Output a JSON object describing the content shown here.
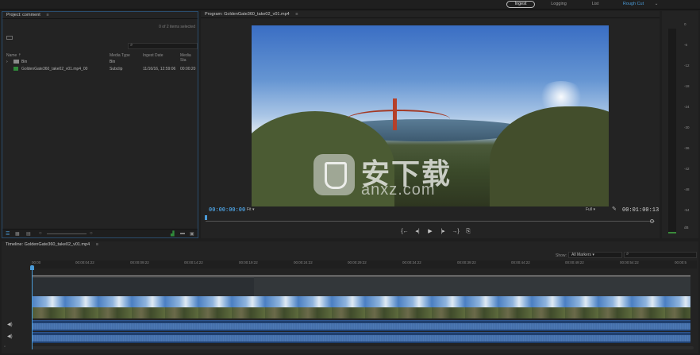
{
  "workspaces": {
    "tabs": [
      {
        "label": "Ingest",
        "active": true
      },
      {
        "label": "Logging",
        "active": false
      },
      {
        "label": "List",
        "active": false
      },
      {
        "label": "Rough Cut",
        "active": false
      }
    ],
    "more_icon": "chevron-down-icon"
  },
  "project": {
    "title": "Project: comment",
    "menu_icon": "≡",
    "selection_count": "0 of 2 items selected",
    "columns": [
      "Name ⇡",
      "Media Type",
      "Ingest Date",
      "Media Sta"
    ],
    "rows": [
      {
        "name": "Bin",
        "type": "Bin",
        "date": "",
        "status": "",
        "icon": "folder-icon"
      },
      {
        "name": "GoldenGate360_take02_v01.mp4_00",
        "type": "Subclip",
        "date": "11/16/16, 12:59:06",
        "status": "00:00:20",
        "icon": "subclip-icon"
      }
    ]
  },
  "program": {
    "title": "Program: GoldenGate360_take02_v01.mp4",
    "menu_icon": "≡",
    "timecode_current": "00:00:00:00",
    "zoom_fit": "Fit",
    "resolution": "Full",
    "timecode_duration": "00:01:00:13",
    "transport": [
      "{←",
      "◂|",
      "▶",
      "|▸",
      "→}",
      "⎘"
    ]
  },
  "watermark": {
    "chinese": "安下载",
    "domain": "anxz.com"
  },
  "meter": {
    "labels": [
      "0",
      "-6",
      "-12",
      "-18",
      "-24",
      "-30",
      "-36",
      "-42",
      "-48",
      "-54",
      "dB"
    ]
  },
  "timeline": {
    "title": "Timeline: GoldenGate360_take02_v01.mp4",
    "menu_icon": "≡",
    "show_label": "Show:",
    "show_value": "All Markers",
    "ruler_ticks": [
      "00:00",
      "00:00:04:22",
      "00:00:09:22",
      "00:00:14:22",
      "00:00:19:22",
      "00:00:24:22",
      "00:00:29:22",
      "00:00:34:22",
      "00:00:39:22",
      "00:00:44:22",
      "00:00:49:22",
      "00:00:54:22",
      "00:00:5"
    ]
  },
  "colors": {
    "accent": "#4a9bd8",
    "panel_bg": "#232323",
    "audio_clip": "#1f3f6e"
  }
}
